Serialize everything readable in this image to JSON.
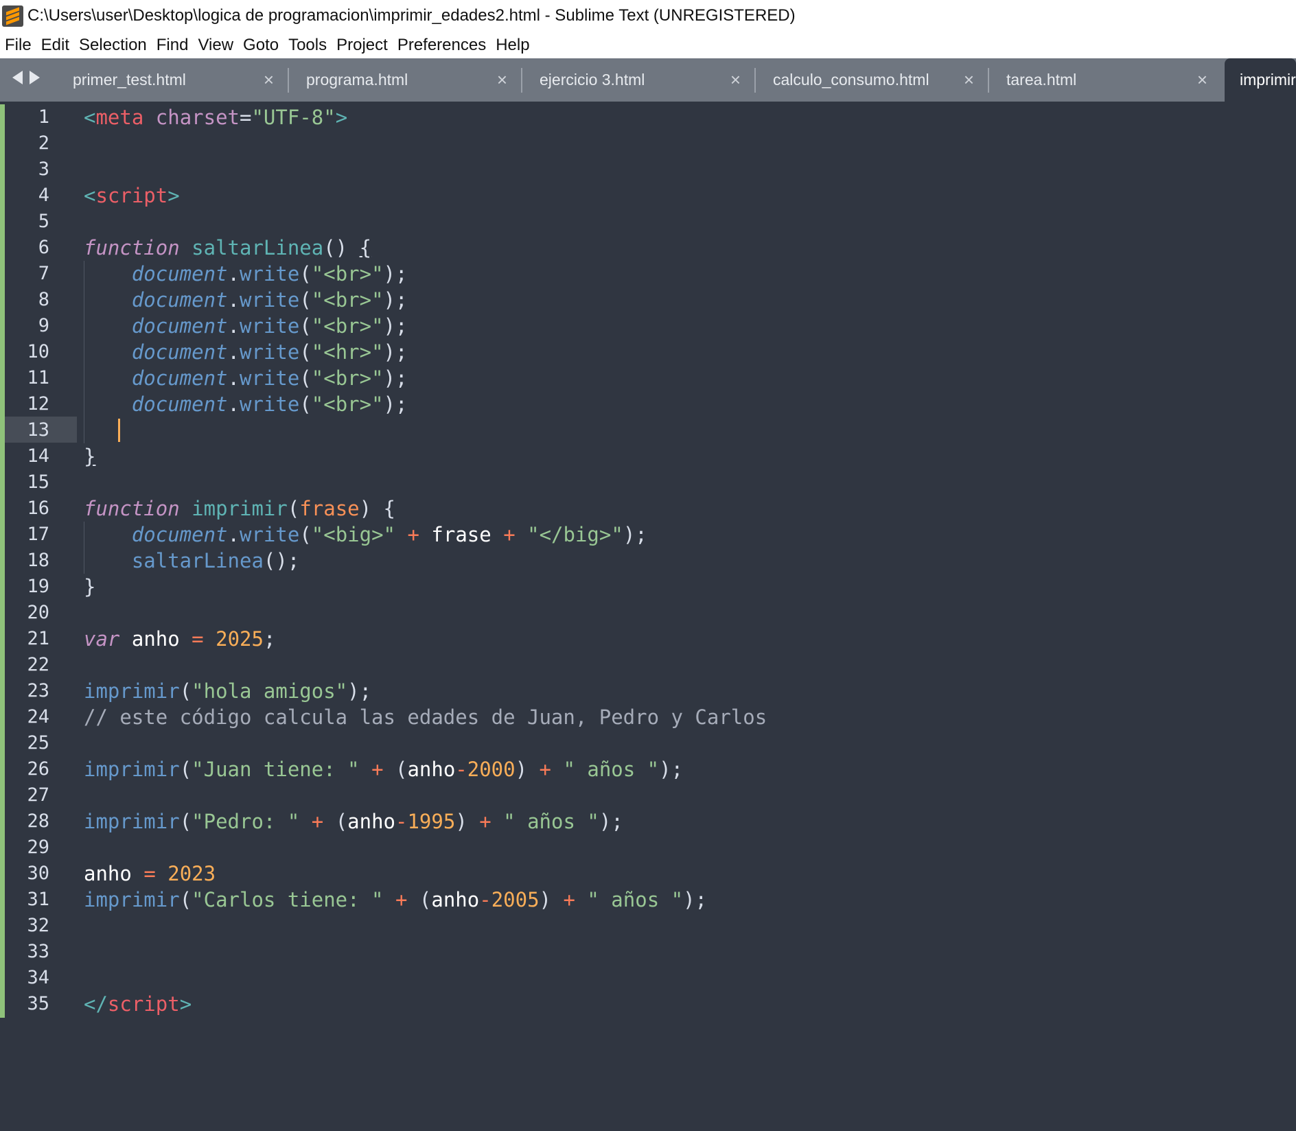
{
  "window": {
    "title": "C:\\Users\\user\\Desktop\\logica de programacion\\imprimir_edades2.html - Sublime Text (UNREGISTERED)"
  },
  "menu": [
    "File",
    "Edit",
    "Selection",
    "Find",
    "View",
    "Goto",
    "Tools",
    "Project",
    "Preferences",
    "Help"
  ],
  "tabs": [
    {
      "label": "primer_test.html",
      "close": "×"
    },
    {
      "label": "programa.html",
      "close": "×"
    },
    {
      "label": "ejercicio 3.html",
      "close": "×"
    },
    {
      "label": "calculo_consumo.html",
      "close": "×"
    },
    {
      "label": "tarea.html",
      "close": "×"
    },
    {
      "label": "imprimir",
      "active": true
    }
  ],
  "editor": {
    "current_line": 13,
    "line_numbers": [
      "1",
      "2",
      "3",
      "4",
      "5",
      "6",
      "7",
      "8",
      "9",
      "10",
      "11",
      "12",
      "13",
      "14",
      "15",
      "16",
      "17",
      "18",
      "19",
      "20",
      "21",
      "22",
      "23",
      "24",
      "25",
      "26",
      "27",
      "28",
      "29",
      "30",
      "31",
      "32",
      "33",
      "34",
      "35"
    ],
    "lines": [
      [
        [
          "tag",
          "<"
        ],
        [
          "tname",
          "meta"
        ],
        [
          "punc",
          " "
        ],
        [
          "attr",
          "charset"
        ],
        [
          "punc",
          "="
        ],
        [
          "str",
          "\"UTF-8\""
        ],
        [
          "tag",
          ">"
        ]
      ],
      [],
      [],
      [
        [
          "tag",
          "<"
        ],
        [
          "tname",
          "script"
        ],
        [
          "tag",
          ">"
        ]
      ],
      [],
      [
        [
          "kw",
          "function"
        ],
        [
          "punc",
          " "
        ],
        [
          "fn",
          "saltarLinea"
        ],
        [
          "punc",
          "() "
        ],
        [
          "punc ul",
          "{"
        ]
      ],
      [
        [
          "punc",
          "    "
        ],
        [
          "obj",
          "document"
        ],
        [
          "punc",
          "."
        ],
        [
          "meth",
          "write"
        ],
        [
          "punc",
          "("
        ],
        [
          "str",
          "\"<br>\""
        ],
        [
          "punc",
          ");"
        ]
      ],
      [
        [
          "punc",
          "    "
        ],
        [
          "obj",
          "document"
        ],
        [
          "punc",
          "."
        ],
        [
          "meth",
          "write"
        ],
        [
          "punc",
          "("
        ],
        [
          "str",
          "\"<br>\""
        ],
        [
          "punc",
          ");"
        ]
      ],
      [
        [
          "punc",
          "    "
        ],
        [
          "obj",
          "document"
        ],
        [
          "punc",
          "."
        ],
        [
          "meth",
          "write"
        ],
        [
          "punc",
          "("
        ],
        [
          "str",
          "\"<br>\""
        ],
        [
          "punc",
          ");"
        ]
      ],
      [
        [
          "punc",
          "    "
        ],
        [
          "obj",
          "document"
        ],
        [
          "punc",
          "."
        ],
        [
          "meth",
          "write"
        ],
        [
          "punc",
          "("
        ],
        [
          "str",
          "\"<hr>\""
        ],
        [
          "punc",
          ");"
        ]
      ],
      [
        [
          "punc",
          "    "
        ],
        [
          "obj",
          "document"
        ],
        [
          "punc",
          "."
        ],
        [
          "meth",
          "write"
        ],
        [
          "punc",
          "("
        ],
        [
          "str",
          "\"<br>\""
        ],
        [
          "punc",
          ");"
        ]
      ],
      [
        [
          "punc",
          "    "
        ],
        [
          "obj",
          "document"
        ],
        [
          "punc",
          "."
        ],
        [
          "meth",
          "write"
        ],
        [
          "punc",
          "("
        ],
        [
          "str",
          "\"<br>\""
        ],
        [
          "punc",
          ");"
        ]
      ],
      [],
      [
        [
          "punc ul",
          "}"
        ]
      ],
      [],
      [
        [
          "kw",
          "function"
        ],
        [
          "punc",
          " "
        ],
        [
          "fn",
          "imprimir"
        ],
        [
          "punc",
          "("
        ],
        [
          "param",
          "frase"
        ],
        [
          "punc",
          ") {"
        ]
      ],
      [
        [
          "punc",
          "    "
        ],
        [
          "obj",
          "document"
        ],
        [
          "punc",
          "."
        ],
        [
          "meth",
          "write"
        ],
        [
          "punc",
          "("
        ],
        [
          "str",
          "\"<big>\""
        ],
        [
          "punc",
          " "
        ],
        [
          "op",
          "+"
        ],
        [
          "punc",
          " "
        ],
        [
          "var",
          "frase"
        ],
        [
          "punc",
          " "
        ],
        [
          "op",
          "+"
        ],
        [
          "punc",
          " "
        ],
        [
          "str",
          "\"</big>\""
        ],
        [
          "punc",
          ");"
        ]
      ],
      [
        [
          "punc",
          "    "
        ],
        [
          "meth",
          "saltarLinea"
        ],
        [
          "punc",
          "();"
        ]
      ],
      [
        [
          "punc",
          "}"
        ]
      ],
      [],
      [
        [
          "kw",
          "var"
        ],
        [
          "punc",
          " "
        ],
        [
          "var",
          "anho"
        ],
        [
          "punc",
          " "
        ],
        [
          "op",
          "="
        ],
        [
          "punc",
          " "
        ],
        [
          "num",
          "2025"
        ],
        [
          "punc",
          ";"
        ]
      ],
      [],
      [
        [
          "meth",
          "imprimir"
        ],
        [
          "punc",
          "("
        ],
        [
          "str",
          "\"hola amigos\""
        ],
        [
          "punc",
          ");"
        ]
      ],
      [
        [
          "cmt",
          "// este código calcula las edades de Juan, Pedro y Carlos"
        ]
      ],
      [],
      [
        [
          "meth",
          "imprimir"
        ],
        [
          "punc",
          "("
        ],
        [
          "str",
          "\"Juan tiene: \""
        ],
        [
          "punc",
          " "
        ],
        [
          "op",
          "+"
        ],
        [
          "punc",
          " ("
        ],
        [
          "var",
          "anho"
        ],
        [
          "op",
          "-"
        ],
        [
          "num",
          "2000"
        ],
        [
          "punc",
          ") "
        ],
        [
          "op",
          "+"
        ],
        [
          "punc",
          " "
        ],
        [
          "str",
          "\" años \""
        ],
        [
          "punc",
          ");"
        ]
      ],
      [],
      [
        [
          "meth",
          "imprimir"
        ],
        [
          "punc",
          "("
        ],
        [
          "str",
          "\"Pedro: \""
        ],
        [
          "punc",
          " "
        ],
        [
          "op",
          "+"
        ],
        [
          "punc",
          " ("
        ],
        [
          "var",
          "anho"
        ],
        [
          "op",
          "-"
        ],
        [
          "num",
          "1995"
        ],
        [
          "punc",
          ") "
        ],
        [
          "op",
          "+"
        ],
        [
          "punc",
          " "
        ],
        [
          "str",
          "\" años \""
        ],
        [
          "punc",
          ");"
        ]
      ],
      [],
      [
        [
          "var",
          "anho"
        ],
        [
          "punc",
          " "
        ],
        [
          "op",
          "="
        ],
        [
          "punc",
          " "
        ],
        [
          "num",
          "2023"
        ]
      ],
      [
        [
          "meth",
          "imprimir"
        ],
        [
          "punc",
          "("
        ],
        [
          "str",
          "\"Carlos tiene: \""
        ],
        [
          "punc",
          " "
        ],
        [
          "op",
          "+"
        ],
        [
          "punc",
          " ("
        ],
        [
          "var",
          "anho"
        ],
        [
          "op",
          "-"
        ],
        [
          "num",
          "2005"
        ],
        [
          "punc",
          ") "
        ],
        [
          "op",
          "+"
        ],
        [
          "punc",
          " "
        ],
        [
          "str",
          "\" años \""
        ],
        [
          "punc",
          ");"
        ]
      ],
      [],
      [],
      [],
      [
        [
          "tag",
          "</"
        ],
        [
          "tname",
          "script"
        ],
        [
          "tag",
          ">"
        ]
      ]
    ]
  }
}
